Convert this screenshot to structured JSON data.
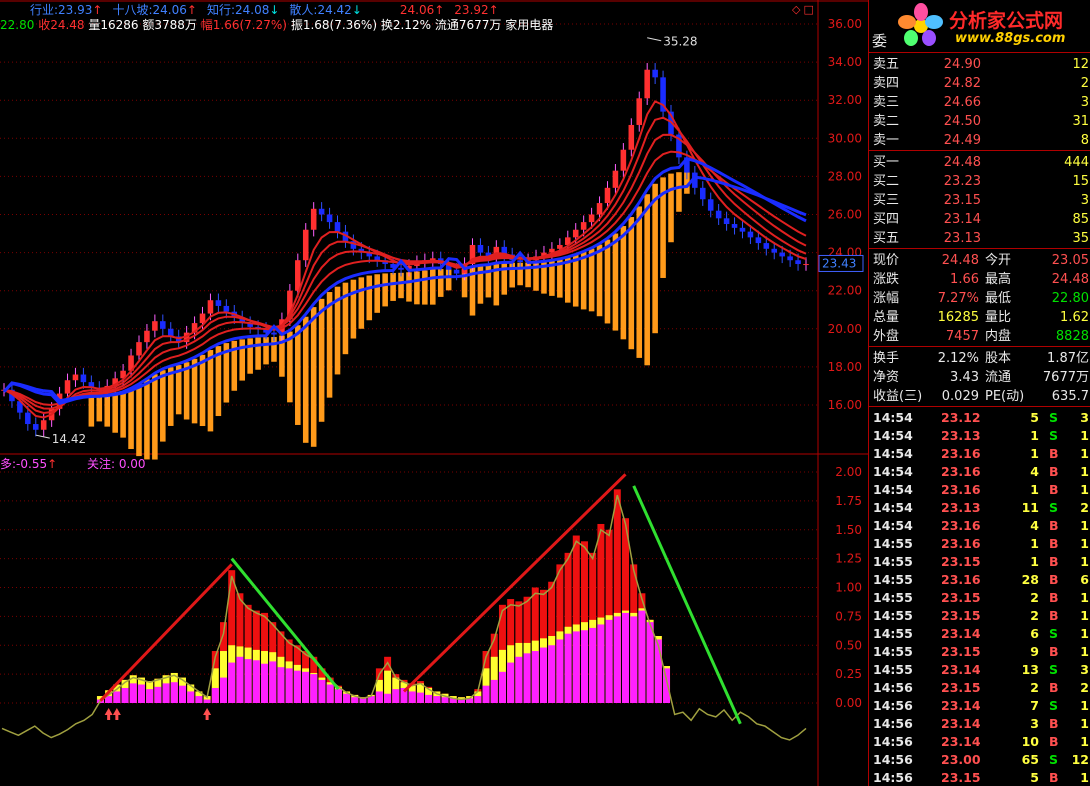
{
  "header": {
    "line1": [
      {
        "text": "行业:23.93",
        "color": "#4080ff",
        "arrow": "↑",
        "arrow_color": "#ff3030"
      },
      {
        "text": "十八坡:24.06",
        "color": "#4080ff",
        "arrow": "↑",
        "arrow_color": "#ff3030"
      },
      {
        "text": "知行:24.08",
        "color": "#4080ff",
        "arrow": "↓",
        "arrow_color": "#00e0e0"
      },
      {
        "text": "散人:24.42",
        "color": "#4080ff",
        "arrow": "↓",
        "arrow_color": "#00e0e0"
      },
      {
        "text": "24.06",
        "color": "#ff3030",
        "arrow": "↑",
        "arrow_color": "#ff3030"
      },
      {
        "text": "23.92",
        "color": "#ff3030",
        "arrow": "↑",
        "arrow_color": "#ff3030"
      }
    ],
    "line2": {
      "low_val": "22.80",
      "close_label": "收24.48",
      "volume": "量16286",
      "amount": "额3788万",
      "change": "幅1.66(7.27%)",
      "amplitude": "振1.68(7.36%)",
      "turnover": "换2.12%",
      "float": "流通7677万",
      "industry": "家用电器"
    },
    "lower_title": {
      "label": "多:-0.55",
      "arrow": "↑",
      "focus": "关注: 0.00"
    }
  },
  "chart_data": [
    {
      "type": "line",
      "title": "",
      "price_axis_ticks": [
        "36.00",
        "34.00",
        "32.00",
        "30.00",
        "28.00",
        "26.00",
        "24.00",
        "22.00",
        "20.00",
        "18.00",
        "16.00"
      ],
      "ylim": [
        15,
        37
      ],
      "high_marker": "35.28",
      "low_marker": "14.42",
      "current_price_tag": "23.43",
      "close_series": [
        16.8,
        16.2,
        15.6,
        15.0,
        14.7,
        15.2,
        15.8,
        16.6,
        17.3,
        17.6,
        17.2,
        16.9,
        16.7,
        17.0,
        17.4,
        17.8,
        18.6,
        19.3,
        19.9,
        20.4,
        20.0,
        19.6,
        19.3,
        19.8,
        20.3,
        20.8,
        21.5,
        21.2,
        20.9,
        20.6,
        20.3,
        20.1,
        20.0,
        19.8,
        19.7,
        20.5,
        22.0,
        23.6,
        25.2,
        26.3,
        26.0,
        25.6,
        25.1,
        24.6,
        24.2,
        24.0,
        23.8,
        23.6,
        23.4,
        23.2,
        23.1,
        23.3,
        23.5,
        23.6,
        23.7,
        23.4,
        23.1,
        22.9,
        23.4,
        24.4,
        24.0,
        23.8,
        24.3,
        23.9,
        23.6,
        23.5,
        23.6,
        23.8,
        24.0,
        24.2,
        24.4,
        24.8,
        25.2,
        25.6,
        26.0,
        26.6,
        27.4,
        28.3,
        29.4,
        30.7,
        32.1,
        33.6,
        33.2,
        31.4,
        30.2,
        29.0,
        28.2,
        27.4,
        26.8,
        26.2,
        25.8,
        25.5,
        25.3,
        25.1,
        24.8,
        24.5,
        24.2,
        24.0,
        23.8,
        23.6,
        23.4,
        23.4
      ],
      "ma_fast_series_name": "",
      "ma_slow_series_name": ""
    },
    {
      "type": "bar",
      "title": "",
      "yaxis_ticks": [
        "2.00",
        "1.75",
        "1.50",
        "1.25",
        "1.00",
        "0.75",
        "0.50",
        "0.25",
        "0.00"
      ],
      "ylim": [
        -0.32,
        2.1
      ],
      "magenta_values": [
        0,
        0,
        0,
        0,
        0,
        0,
        0,
        0,
        0,
        0,
        0,
        0,
        0.03,
        0.06,
        0.1,
        0.13,
        0.17,
        0.16,
        0.12,
        0.14,
        0.17,
        0.18,
        0.15,
        0.1,
        0.06,
        0.03,
        0.13,
        0.22,
        0.35,
        0.4,
        0.38,
        0.37,
        0.34,
        0.36,
        0.31,
        0.3,
        0.28,
        0.27,
        0.25,
        0.2,
        0.16,
        0.12,
        0.08,
        0.05,
        0.04,
        0.06,
        0.1,
        0.08,
        0.12,
        0.13,
        0.1,
        0.09,
        0.07,
        0.06,
        0.05,
        0.04,
        0.03,
        0.04,
        0.06,
        0.15,
        0.2,
        0.27,
        0.35,
        0.4,
        0.43,
        0.45,
        0.48,
        0.5,
        0.55,
        0.6,
        0.62,
        0.63,
        0.65,
        0.68,
        0.72,
        0.75,
        0.78,
        0.75,
        0.8,
        0.7,
        0.55,
        0.3,
        0,
        0,
        0,
        0,
        0,
        0,
        0,
        0,
        0,
        0,
        0,
        0,
        0,
        0,
        0,
        0,
        0
      ],
      "yellow_values": [
        0,
        0,
        0,
        0,
        0,
        0,
        0,
        0,
        0,
        0,
        0,
        0,
        0.06,
        0.11,
        0.16,
        0.2,
        0.24,
        0.22,
        0.19,
        0.21,
        0.24,
        0.26,
        0.22,
        0.16,
        0.1,
        0.06,
        0.3,
        0.45,
        0.5,
        0.49,
        0.48,
        0.46,
        0.45,
        0.44,
        0.4,
        0.36,
        0.33,
        0.3,
        0.26,
        0.22,
        0.18,
        0.14,
        0.1,
        0.07,
        0.05,
        0.07,
        0.2,
        0.28,
        0.22,
        0.18,
        0.15,
        0.17,
        0.13,
        0.1,
        0.08,
        0.06,
        0.05,
        0.06,
        0.1,
        0.3,
        0.4,
        0.46,
        0.5,
        0.52,
        0.52,
        0.54,
        0.56,
        0.58,
        0.62,
        0.66,
        0.68,
        0.7,
        0.72,
        0.74,
        0.76,
        0.78,
        0.8,
        0.78,
        0.82,
        0.72,
        0.58,
        0.32,
        0,
        0,
        0,
        0,
        0,
        0,
        0,
        0,
        0,
        0,
        0,
        0,
        0,
        0,
        0,
        0,
        0
      ],
      "red_values": [
        0,
        0,
        0,
        0,
        0,
        0,
        0,
        0,
        0,
        0,
        0,
        0,
        0.06,
        0.11,
        0.16,
        0.2,
        0.24,
        0.22,
        0.19,
        0.21,
        0.24,
        0.26,
        0.22,
        0.16,
        0.1,
        0.06,
        0.45,
        0.7,
        1.15,
        0.95,
        0.85,
        0.8,
        0.78,
        0.7,
        0.62,
        0.55,
        0.5,
        0.45,
        0.4,
        0.3,
        0.22,
        0.15,
        0.1,
        0.07,
        0.05,
        0.07,
        0.3,
        0.4,
        0.25,
        0.2,
        0.17,
        0.19,
        0.14,
        0.1,
        0.08,
        0.06,
        0.05,
        0.06,
        0.12,
        0.45,
        0.6,
        0.85,
        0.9,
        0.88,
        0.92,
        1.0,
        0.98,
        1.05,
        1.2,
        1.3,
        1.45,
        1.4,
        1.3,
        1.55,
        1.5,
        1.85,
        1.6,
        1.2,
        0.95,
        0.72,
        0.58,
        0.32,
        0,
        0,
        0,
        0,
        0,
        0,
        0,
        0,
        0,
        0,
        0,
        0,
        0,
        0,
        0,
        0,
        0
      ],
      "line_values": [
        -0.22,
        -0.25,
        -0.28,
        -0.24,
        -0.2,
        -0.26,
        -0.3,
        -0.27,
        -0.23,
        -0.18,
        -0.15,
        -0.1,
        0.02,
        0.07,
        0.12,
        0.18,
        0.22,
        0.2,
        0.18,
        0.2,
        0.22,
        0.24,
        0.2,
        0.15,
        0.1,
        0.05,
        0.4,
        0.6,
        1.1,
        0.9,
        0.82,
        0.78,
        0.75,
        0.68,
        0.6,
        0.52,
        0.48,
        0.42,
        0.38,
        0.28,
        0.2,
        0.14,
        0.09,
        0.06,
        0.04,
        0.06,
        0.25,
        0.35,
        0.22,
        0.18,
        0.15,
        0.17,
        0.12,
        0.08,
        0.06,
        0.04,
        0.03,
        0.04,
        0.1,
        0.4,
        0.55,
        0.8,
        0.85,
        0.84,
        0.88,
        0.95,
        0.94,
        1.0,
        1.15,
        1.25,
        1.4,
        1.35,
        1.25,
        1.5,
        1.45,
        1.8,
        1.55,
        1.15,
        0.9,
        0.68,
        0.5,
        0.2,
        -0.1,
        -0.08,
        -0.15,
        -0.05,
        -0.1,
        -0.12,
        -0.06,
        -0.15,
        -0.08,
        -0.12,
        -0.18,
        -0.2,
        -0.25,
        -0.3,
        -0.32,
        -0.28,
        -0.22
      ]
    }
  ],
  "quote": {
    "logo_text": "分析家公式网",
    "logo_url_text": "www.88gs.com",
    "committee_label": "委",
    "sell": [
      {
        "label": "卖五",
        "price": "24.90",
        "vol": "12"
      },
      {
        "label": "卖四",
        "price": "24.82",
        "vol": "2"
      },
      {
        "label": "卖三",
        "price": "24.66",
        "vol": "3"
      },
      {
        "label": "卖二",
        "price": "24.50",
        "vol": "31"
      },
      {
        "label": "卖一",
        "price": "24.49",
        "vol": "8"
      }
    ],
    "buy": [
      {
        "label": "买一",
        "price": "24.48",
        "vol": "444"
      },
      {
        "label": "买二",
        "price": "23.23",
        "vol": "15"
      },
      {
        "label": "买三",
        "price": "23.15",
        "vol": "3"
      },
      {
        "label": "买四",
        "price": "23.14",
        "vol": "85"
      },
      {
        "label": "买五",
        "price": "23.13",
        "vol": "35"
      }
    ],
    "stats": [
      {
        "l1": "现价",
        "v1": "24.48",
        "c1": "#ff5050",
        "l2": "今开",
        "v2": "23.05",
        "c2": "#ff5050"
      },
      {
        "l1": "涨跌",
        "v1": "1.66",
        "c1": "#ff5050",
        "l2": "最高",
        "v2": "24.48",
        "c2": "#ff5050"
      },
      {
        "l1": "涨幅",
        "v1": "7.27%",
        "c1": "#ff5050",
        "l2": "最低",
        "v2": "22.80",
        "c2": "#00e000"
      },
      {
        "l1": "总量",
        "v1": "16285",
        "c1": "#ffff40",
        "l2": "量比",
        "v2": "1.62",
        "c2": "#ffff40"
      },
      {
        "l1": "外盘",
        "v1": "7457",
        "c1": "#ff5050",
        "l2": "内盘",
        "v2": "8828",
        "c2": "#00e000"
      }
    ],
    "stats2": [
      {
        "l1": "换手",
        "v1": "2.12%",
        "l2": "股本",
        "v2": "1.87亿"
      },
      {
        "l1": "净资",
        "v1": "3.43",
        "l2": "流通",
        "v2": "7677万"
      },
      {
        "l1": "收益(三)",
        "v1": "0.029",
        "l2": "PE(动)",
        "v2": "635.7"
      }
    ],
    "ticks": [
      {
        "t": "14:54",
        "p": "23.12",
        "v": "5",
        "s": "S",
        "n": "3"
      },
      {
        "t": "14:54",
        "p": "23.13",
        "v": "1",
        "s": "S",
        "n": "1"
      },
      {
        "t": "14:54",
        "p": "23.16",
        "v": "1",
        "s": "B",
        "n": "1"
      },
      {
        "t": "14:54",
        "p": "23.16",
        "v": "4",
        "s": "B",
        "n": "1"
      },
      {
        "t": "14:54",
        "p": "23.16",
        "v": "1",
        "s": "B",
        "n": "1"
      },
      {
        "t": "14:54",
        "p": "23.13",
        "v": "11",
        "s": "S",
        "n": "2"
      },
      {
        "t": "14:54",
        "p": "23.16",
        "v": "4",
        "s": "B",
        "n": "1"
      },
      {
        "t": "14:55",
        "p": "23.16",
        "v": "1",
        "s": "B",
        "n": "1"
      },
      {
        "t": "14:55",
        "p": "23.15",
        "v": "1",
        "s": "B",
        "n": "1"
      },
      {
        "t": "14:55",
        "p": "23.16",
        "v": "28",
        "s": "B",
        "n": "6"
      },
      {
        "t": "14:55",
        "p": "23.15",
        "v": "2",
        "s": "B",
        "n": "1"
      },
      {
        "t": "14:55",
        "p": "23.15",
        "v": "2",
        "s": "B",
        "n": "1"
      },
      {
        "t": "14:55",
        "p": "23.14",
        "v": "6",
        "s": "S",
        "n": "1"
      },
      {
        "t": "14:55",
        "p": "23.15",
        "v": "9",
        "s": "B",
        "n": "1"
      },
      {
        "t": "14:55",
        "p": "23.14",
        "v": "13",
        "s": "S",
        "n": "3"
      },
      {
        "t": "14:56",
        "p": "23.15",
        "v": "2",
        "s": "B",
        "n": "2"
      },
      {
        "t": "14:56",
        "p": "23.14",
        "v": "7",
        "s": "S",
        "n": "1"
      },
      {
        "t": "14:56",
        "p": "23.14",
        "v": "3",
        "s": "B",
        "n": "1"
      },
      {
        "t": "14:56",
        "p": "23.14",
        "v": "10",
        "s": "B",
        "n": "1"
      },
      {
        "t": "14:56",
        "p": "23.00",
        "v": "65",
        "s": "S",
        "n": "12"
      },
      {
        "t": "14:56",
        "p": "23.15",
        "v": "5",
        "s": "B",
        "n": "1"
      }
    ]
  },
  "colors": {
    "border": "#b00000",
    "grid": "#7a0000",
    "up": "#ff3030",
    "down": "#00e0e0",
    "bar_orange": "#ff9a1a",
    "ma_red": "#e02020",
    "ma_blue": "#1a2cff",
    "magenta": "#ff20ff",
    "yellow": "#ffff30",
    "trend_red": "#e01818",
    "trend_green": "#30e030"
  }
}
